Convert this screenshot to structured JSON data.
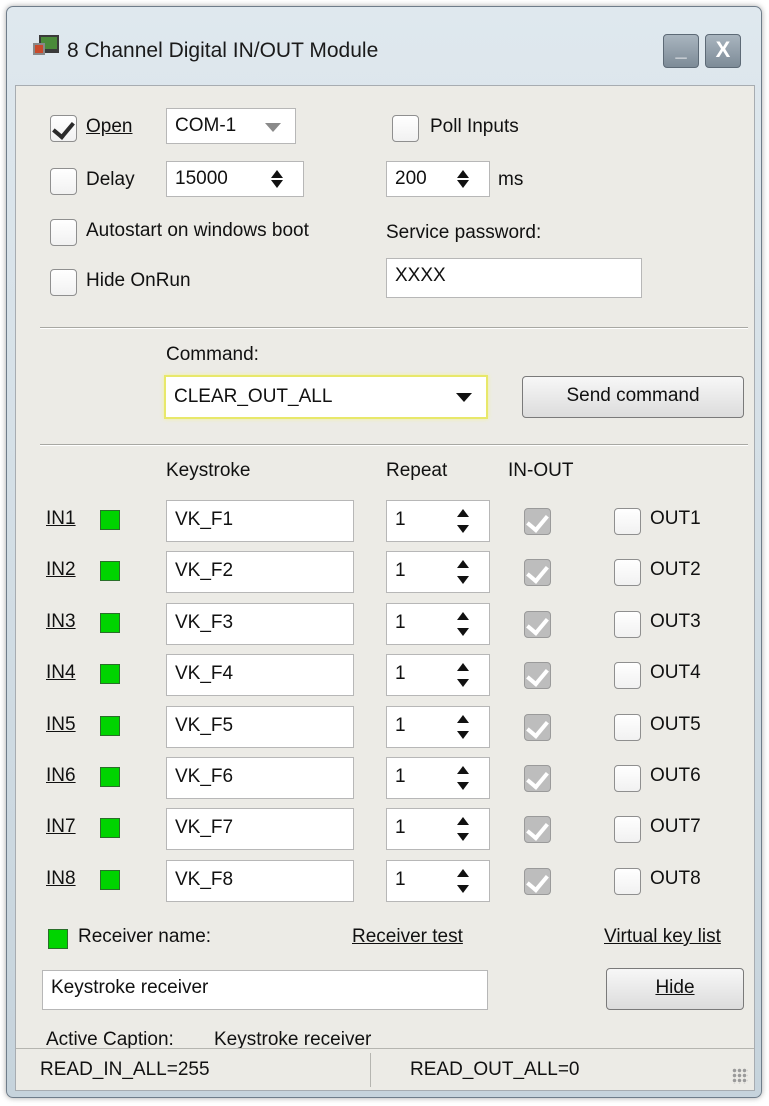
{
  "window": {
    "title": "8 Channel Digital IN/OUT Module",
    "min_label": "_",
    "close_label": "X"
  },
  "top": {
    "open_label": "Open",
    "open_checked": true,
    "com_port": "COM-1",
    "poll_label": "Poll Inputs",
    "delay_label": "Delay",
    "delay_value": "15000",
    "poll_value": "200",
    "poll_unit": "ms",
    "autostart_label": "Autostart on windows boot",
    "service_password_label": "Service password:",
    "service_password_value": "XXXX",
    "hide_onrun_label": "Hide OnRun"
  },
  "command": {
    "label": "Command:",
    "value": "CLEAR_OUT_ALL",
    "send_button": "Send command"
  },
  "grid": {
    "headers": {
      "keystroke": "Keystroke",
      "repeat": "Repeat",
      "inout": "IN-OUT"
    },
    "rows": [
      {
        "in": "IN1",
        "key": "VK_F1",
        "repeat": "1",
        "out": "OUT1"
      },
      {
        "in": "IN2",
        "key": "VK_F2",
        "repeat": "1",
        "out": "OUT2"
      },
      {
        "in": "IN3",
        "key": "VK_F3",
        "repeat": "1",
        "out": "OUT3"
      },
      {
        "in": "IN4",
        "key": "VK_F4",
        "repeat": "1",
        "out": "OUT4"
      },
      {
        "in": "IN5",
        "key": "VK_F5",
        "repeat": "1",
        "out": "OUT5"
      },
      {
        "in": "IN6",
        "key": "VK_F6",
        "repeat": "1",
        "out": "OUT6"
      },
      {
        "in": "IN7",
        "key": "VK_F7",
        "repeat": "1",
        "out": "OUT7"
      },
      {
        "in": "IN8",
        "key": "VK_F8",
        "repeat": "1",
        "out": "OUT8"
      }
    ]
  },
  "receiver": {
    "name_label": "Receiver name:",
    "test_link": "Receiver test",
    "vk_link": "Virtual key list",
    "name_value": "Keystroke receiver",
    "hide_button": "Hide",
    "active_caption_label": "Active Caption:",
    "active_caption_value": "Keystroke receiver"
  },
  "status": {
    "left": "READ_IN_ALL=255",
    "right": "READ_OUT_ALL=0"
  },
  "colors": {
    "led": "#00d400",
    "focus_glow": "#f2f29a"
  }
}
